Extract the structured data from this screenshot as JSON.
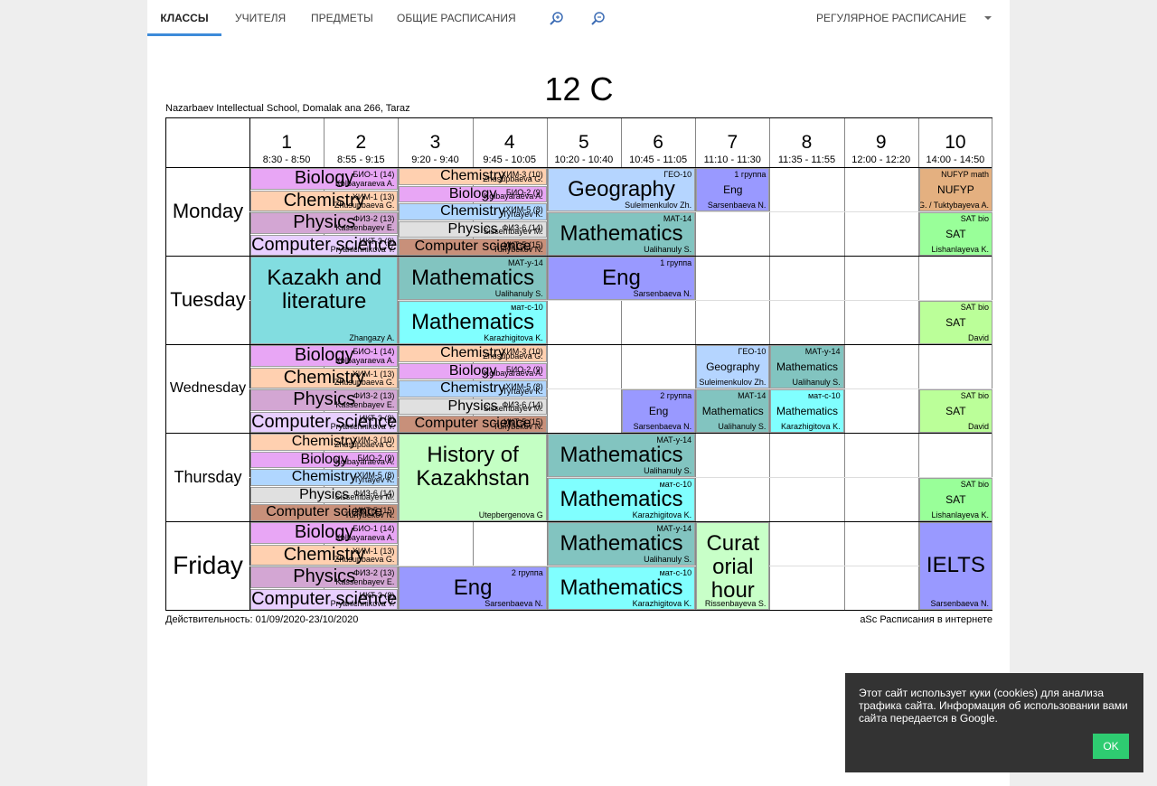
{
  "nav": {
    "tabs": [
      "КЛАССЫ",
      "УЧИТЕЛЯ",
      "ПРЕДМЕТЫ",
      "ОБЩИЕ РАСПИСАНИЯ"
    ],
    "active_tab": "КЛАССЫ",
    "schedule_select": "РЕГУЛЯРНОЕ РАСПИСАНИЕ",
    "zoom_in_icon": "zoom-in-icon",
    "zoom_out_icon": "zoom-out-icon",
    "accent": "#3d8bd9"
  },
  "title": "12 C",
  "school": "Nazarbaev Intellectual School, Domalak ana 266, Taraz",
  "validity": "Действительность: 01/09/2020-23/10/2020",
  "credit": "aSc Расписания в интернете",
  "periods": [
    {
      "num": "1",
      "time": "8:30 - 8:50"
    },
    {
      "num": "2",
      "time": "8:55 - 9:15"
    },
    {
      "num": "3",
      "time": "9:20 - 9:40"
    },
    {
      "num": "4",
      "time": "9:45 - 10:05"
    },
    {
      "num": "5",
      "time": "10:20 - 10:40"
    },
    {
      "num": "6",
      "time": "10:45 - 11:05"
    },
    {
      "num": "7",
      "time": "11:10 - 11:30"
    },
    {
      "num": "8",
      "time": "11:35 - 11:55"
    },
    {
      "num": "9",
      "time": "12:00 - 12:20"
    },
    {
      "num": "10",
      "time": "14:00 - 14:50"
    }
  ],
  "days": [
    "Monday",
    "Tuesday",
    "Wednesday",
    "Thursday",
    "Friday"
  ],
  "colors": {
    "biology": "#e8a6f5",
    "chemistry": "#ffd0b0",
    "chemistry_blue": "#b0d6ff",
    "physics": "#d3a6d3",
    "physics_grey": "#e0e0e0",
    "cs": "#e8cfff",
    "cs_brown": "#c8907a",
    "geography": "#b5d5ff",
    "math_teal": "#82c4c0",
    "math_cyan": "#80ffff",
    "eng": "#9999ff",
    "kazakh": "#82dde0",
    "history": "#c4ffc4",
    "sat": "#99ff99",
    "sat_green": "#bbff99",
    "nufyp": "#e4b080",
    "curator": "#c8ffc8",
    "ielts": "#9999ff"
  },
  "lessons": [
    {
      "d": 0,
      "p": 0,
      "s": 2,
      "r": 0,
      "rs": 1,
      "n": 4,
      "subj": "Biology",
      "code": "БИО-1 (14)",
      "tch": "Kolbayaraeva A.",
      "c": "biology",
      "fs": 20
    },
    {
      "d": 0,
      "p": 0,
      "s": 2,
      "r": 1,
      "rs": 1,
      "n": 4,
      "subj": "Chemistry",
      "code": "ХИМ-1 (13)",
      "tch": "Zhusupbaeva G.",
      "c": "chemistry",
      "fs": 20
    },
    {
      "d": 0,
      "p": 0,
      "s": 2,
      "r": 2,
      "rs": 1,
      "n": 4,
      "subj": "Physics",
      "code": "ФИЗ-2 (13)",
      "tch": "Kassenbayev E.",
      "c": "physics",
      "fs": 20
    },
    {
      "d": 0,
      "p": 0,
      "s": 2,
      "r": 3,
      "rs": 1,
      "n": 4,
      "subj": "Computer science",
      "code": "ИКТ-3 (8)",
      "tch": "Pryanichnikova Y.",
      "c": "cs",
      "fs": 20
    },
    {
      "d": 0,
      "p": 2,
      "s": 2,
      "r": 0,
      "rs": 1,
      "n": 5,
      "subj": "Chemistry",
      "code": "ХИМ-3 (10)",
      "tch": "Zhusupbaeva G.",
      "c": "chemistry",
      "fs": 16
    },
    {
      "d": 0,
      "p": 2,
      "s": 2,
      "r": 1,
      "rs": 1,
      "n": 5,
      "subj": "Biology",
      "code": "БИО-2 (9)",
      "tch": "Kolbayaraeva A.",
      "c": "biology",
      "fs": 16
    },
    {
      "d": 0,
      "p": 2,
      "s": 2,
      "r": 2,
      "rs": 1,
      "n": 5,
      "subj": "Chemistry",
      "code": "ХИМ-5 (8)",
      "tch": "Tyrtayev K.",
      "c": "chemistry_blue",
      "fs": 16
    },
    {
      "d": 0,
      "p": 2,
      "s": 2,
      "r": 3,
      "rs": 1,
      "n": 5,
      "subj": "Physics",
      "code": "ФИЗ-6 (14)",
      "tch": "Sissembayev M.",
      "c": "physics_grey",
      "fs": 16
    },
    {
      "d": 0,
      "p": 2,
      "s": 2,
      "r": 4,
      "rs": 1,
      "n": 5,
      "subj": "Computer science",
      "code": "ИКТ-5 (15)",
      "tch": "Turlybekov N.",
      "c": "cs_brown",
      "fs": 16
    },
    {
      "d": 0,
      "p": 4,
      "s": 2,
      "r": 0,
      "rs": 1,
      "n": 2,
      "subj": "Geography",
      "code": "ГЕО-10",
      "tch": "Suleimenkulov Zh.",
      "c": "geography",
      "fs": 24
    },
    {
      "d": 0,
      "p": 4,
      "s": 2,
      "r": 1,
      "rs": 1,
      "n": 2,
      "subj": "Mathematics",
      "code": "МАТ-14",
      "tch": "Ualihanuly S.",
      "c": "math_teal",
      "fs": 24
    },
    {
      "d": 0,
      "p": 6,
      "s": 1,
      "r": 0,
      "rs": 1,
      "n": 2,
      "subj": "Eng",
      "code": "1 группа",
      "tch": "Sarsenbaeva N.",
      "c": "eng",
      "fs": 12
    },
    {
      "d": 0,
      "p": 9,
      "s": 1,
      "r": 0,
      "rs": 1,
      "n": 2,
      "subj": "NUFYP",
      "code": "NUFYP math",
      "tch": "Akhmediya G. / Tuktybayeva A.",
      "c": "nufyp",
      "fs": 12
    },
    {
      "d": 0,
      "p": 9,
      "s": 1,
      "r": 1,
      "rs": 1,
      "n": 2,
      "subj": "SAT",
      "code": "SAT bio",
      "tch": "Lishanlayeva K.",
      "c": "sat",
      "fs": 12
    },
    {
      "d": 1,
      "p": 0,
      "s": 2,
      "r": 0,
      "rs": 1,
      "n": 1,
      "subj": "Kazakh and literature",
      "code": "",
      "tch": "Zhangazy A.",
      "c": "kazakh",
      "fs": 24
    },
    {
      "d": 1,
      "p": 2,
      "s": 2,
      "r": 0,
      "rs": 1,
      "n": 2,
      "subj": "Mathematics",
      "code": "МАТ-у-14",
      "tch": "Ualihanuly S.",
      "c": "math_teal",
      "fs": 24
    },
    {
      "d": 1,
      "p": 2,
      "s": 2,
      "r": 1,
      "rs": 1,
      "n": 2,
      "subj": "Mathematics",
      "code": "мат-с-10",
      "tch": "Karazhigitova K.",
      "c": "math_cyan",
      "fs": 24
    },
    {
      "d": 1,
      "p": 4,
      "s": 2,
      "r": 0,
      "rs": 1,
      "n": 2,
      "subj": "Eng",
      "code": "1 группа",
      "tch": "Sarsenbaeva N.",
      "c": "eng",
      "fs": 24
    },
    {
      "d": 1,
      "p": 9,
      "s": 1,
      "r": 1,
      "rs": 1,
      "n": 2,
      "subj": "SAT",
      "code": "SAT bio",
      "tch": "David",
      "c": "sat_green",
      "fs": 12
    },
    {
      "d": 2,
      "p": 0,
      "s": 2,
      "r": 0,
      "rs": 1,
      "n": 4,
      "subj": "Biology",
      "code": "БИО-1 (14)",
      "tch": "Kolbayaraeva A.",
      "c": "biology",
      "fs": 20
    },
    {
      "d": 2,
      "p": 0,
      "s": 2,
      "r": 1,
      "rs": 1,
      "n": 4,
      "subj": "Chemistry",
      "code": "ХИМ-1 (13)",
      "tch": "Zhusupbaeva G.",
      "c": "chemistry",
      "fs": 20
    },
    {
      "d": 2,
      "p": 0,
      "s": 2,
      "r": 2,
      "rs": 1,
      "n": 4,
      "subj": "Physics",
      "code": "ФИЗ-2 (13)",
      "tch": "Kassenbayev E.",
      "c": "physics",
      "fs": 20
    },
    {
      "d": 2,
      "p": 0,
      "s": 2,
      "r": 3,
      "rs": 1,
      "n": 4,
      "subj": "Computer science",
      "code": "ИКТ-3 (8)",
      "tch": "Pryanichnikova Y.",
      "c": "cs",
      "fs": 20
    },
    {
      "d": 2,
      "p": 2,
      "s": 2,
      "r": 0,
      "rs": 1,
      "n": 5,
      "subj": "Chemistry",
      "code": "ХИМ-3 (10)",
      "tch": "Zhusupbaeva G.",
      "c": "chemistry",
      "fs": 16
    },
    {
      "d": 2,
      "p": 2,
      "s": 2,
      "r": 1,
      "rs": 1,
      "n": 5,
      "subj": "Biology",
      "code": "БИО-2 (9)",
      "tch": "Kolbayaraeva A.",
      "c": "biology",
      "fs": 16
    },
    {
      "d": 2,
      "p": 2,
      "s": 2,
      "r": 2,
      "rs": 1,
      "n": 5,
      "subj": "Chemistry",
      "code": "ХИМ-5 (8)",
      "tch": "Tyrtayev K.",
      "c": "chemistry_blue",
      "fs": 16
    },
    {
      "d": 2,
      "p": 2,
      "s": 2,
      "r": 3,
      "rs": 1,
      "n": 5,
      "subj": "Physics",
      "code": "ФИЗ-6 (14)",
      "tch": "Sissembayev M.",
      "c": "physics_grey",
      "fs": 16
    },
    {
      "d": 2,
      "p": 2,
      "s": 2,
      "r": 4,
      "rs": 1,
      "n": 5,
      "subj": "Computer science",
      "code": "ИКТ-5 (15)",
      "tch": "Turlybekov N.",
      "c": "cs_brown",
      "fs": 16
    },
    {
      "d": 2,
      "p": 5,
      "s": 1,
      "r": 1,
      "rs": 1,
      "n": 2,
      "subj": "Eng",
      "code": "2 группа",
      "tch": "Sarsenbaeva N.",
      "c": "eng",
      "fs": 12
    },
    {
      "d": 2,
      "p": 6,
      "s": 1,
      "r": 0,
      "rs": 1,
      "n": 2,
      "subj": "Geography",
      "code": "ГЕО-10",
      "tch": "Suleimenkulov Zh.",
      "c": "geography",
      "fs": 12
    },
    {
      "d": 2,
      "p": 6,
      "s": 1,
      "r": 1,
      "rs": 1,
      "n": 2,
      "subj": "Mathematics",
      "code": "МАТ-14",
      "tch": "Ualihanuly S.",
      "c": "math_teal",
      "fs": 12
    },
    {
      "d": 2,
      "p": 7,
      "s": 1,
      "r": 0,
      "rs": 1,
      "n": 2,
      "subj": "Mathematics",
      "code": "МАТ-у-14",
      "tch": "Ualihanuly S.",
      "c": "math_teal",
      "fs": 12
    },
    {
      "d": 2,
      "p": 7,
      "s": 1,
      "r": 1,
      "rs": 1,
      "n": 2,
      "subj": "Mathematics",
      "code": "мат-с-10",
      "tch": "Karazhigitova K.",
      "c": "math_cyan",
      "fs": 12
    },
    {
      "d": 2,
      "p": 9,
      "s": 1,
      "r": 1,
      "rs": 1,
      "n": 2,
      "subj": "SAT",
      "code": "SAT bio",
      "tch": "David",
      "c": "sat_green",
      "fs": 12
    },
    {
      "d": 3,
      "p": 0,
      "s": 2,
      "r": 0,
      "rs": 1,
      "n": 5,
      "subj": "Chemistry",
      "code": "ХИМ-3 (10)",
      "tch": "Zhusupbaeva G.",
      "c": "chemistry",
      "fs": 16
    },
    {
      "d": 3,
      "p": 0,
      "s": 2,
      "r": 1,
      "rs": 1,
      "n": 5,
      "subj": "Biology",
      "code": "БИО-2 (9)",
      "tch": "Kolbayaraeva A.",
      "c": "biology",
      "fs": 16
    },
    {
      "d": 3,
      "p": 0,
      "s": 2,
      "r": 2,
      "rs": 1,
      "n": 5,
      "subj": "Chemistry",
      "code": "ХИМ-5 (8)",
      "tch": "Tyrtayev K.",
      "c": "chemistry_blue",
      "fs": 16
    },
    {
      "d": 3,
      "p": 0,
      "s": 2,
      "r": 3,
      "rs": 1,
      "n": 5,
      "subj": "Physics",
      "code": "ФИЗ-6 (14)",
      "tch": "Sissembayev M.",
      "c": "physics_grey",
      "fs": 16
    },
    {
      "d": 3,
      "p": 0,
      "s": 2,
      "r": 4,
      "rs": 1,
      "n": 5,
      "subj": "Computer science",
      "code": "ИКТ-5 (15)",
      "tch": "Turlybekov N.",
      "c": "cs_brown",
      "fs": 16
    },
    {
      "d": 3,
      "p": 2,
      "s": 2,
      "r": 0,
      "rs": 1,
      "n": 1,
      "subj": "History of Kazakhstan",
      "code": "",
      "tch": "Utepbergenova G",
      "c": "history",
      "fs": 24
    },
    {
      "d": 3,
      "p": 4,
      "s": 2,
      "r": 0,
      "rs": 1,
      "n": 2,
      "subj": "Mathematics",
      "code": "МАТ-у-14",
      "tch": "Ualihanuly S.",
      "c": "math_teal",
      "fs": 24
    },
    {
      "d": 3,
      "p": 4,
      "s": 2,
      "r": 1,
      "rs": 1,
      "n": 2,
      "subj": "Mathematics",
      "code": "мат-с-10",
      "tch": "Karazhigitova K.",
      "c": "math_cyan",
      "fs": 24
    },
    {
      "d": 3,
      "p": 9,
      "s": 1,
      "r": 1,
      "rs": 1,
      "n": 2,
      "subj": "SAT",
      "code": "SAT bio",
      "tch": "Lishanlayeva K.",
      "c": "sat",
      "fs": 12
    },
    {
      "d": 4,
      "p": 0,
      "s": 2,
      "r": 0,
      "rs": 1,
      "n": 4,
      "subj": "Biology",
      "code": "БИО-1 (14)",
      "tch": "Kolbayaraeva A.",
      "c": "biology",
      "fs": 20
    },
    {
      "d": 4,
      "p": 0,
      "s": 2,
      "r": 1,
      "rs": 1,
      "n": 4,
      "subj": "Chemistry",
      "code": "ХИМ-1 (13)",
      "tch": "Zhusupbaeva G.",
      "c": "chemistry",
      "fs": 20
    },
    {
      "d": 4,
      "p": 0,
      "s": 2,
      "r": 2,
      "rs": 1,
      "n": 4,
      "subj": "Physics",
      "code": "ФИЗ-2 (13)",
      "tch": "Kassenbayev E.",
      "c": "physics",
      "fs": 20
    },
    {
      "d": 4,
      "p": 0,
      "s": 2,
      "r": 3,
      "rs": 1,
      "n": 4,
      "subj": "Computer science",
      "code": "ИКТ-3 (8)",
      "tch": "Pryanichnikova Y.",
      "c": "cs",
      "fs": 20
    },
    {
      "d": 4,
      "p": 2,
      "s": 2,
      "r": 1,
      "rs": 1,
      "n": 2,
      "subj": "Eng",
      "code": "2 группа",
      "tch": "Sarsenbaeva N.",
      "c": "eng",
      "fs": 24
    },
    {
      "d": 4,
      "p": 4,
      "s": 2,
      "r": 0,
      "rs": 1,
      "n": 2,
      "subj": "Mathematics",
      "code": "МАТ-у-14",
      "tch": "Ualihanuly S.",
      "c": "math_teal",
      "fs": 24
    },
    {
      "d": 4,
      "p": 4,
      "s": 2,
      "r": 1,
      "rs": 1,
      "n": 2,
      "subj": "Mathematics",
      "code": "мат-с-10",
      "tch": "Karazhigitova K.",
      "c": "math_cyan",
      "fs": 24
    },
    {
      "d": 4,
      "p": 6,
      "s": 1,
      "r": 0,
      "rs": 1,
      "n": 1,
      "subj": "Curat orial hour",
      "code": "",
      "tch": "Rissenbayeva S.",
      "c": "curator",
      "fs": 24
    },
    {
      "d": 4,
      "p": 9,
      "s": 1,
      "r": 0,
      "rs": 1,
      "n": 1,
      "subj": "IELTS",
      "code": "",
      "tch": "Sarsenbaeva N.",
      "c": "ielts",
      "fs": 24
    }
  ],
  "cookie": {
    "text": "Этот сайт использует куки (cookies) для анализа трафика сайта. Информация об использовании вами сайта передается в Google.",
    "ok": "OK",
    "bg": "#333333",
    "ok_color": "#2ecc71"
  }
}
